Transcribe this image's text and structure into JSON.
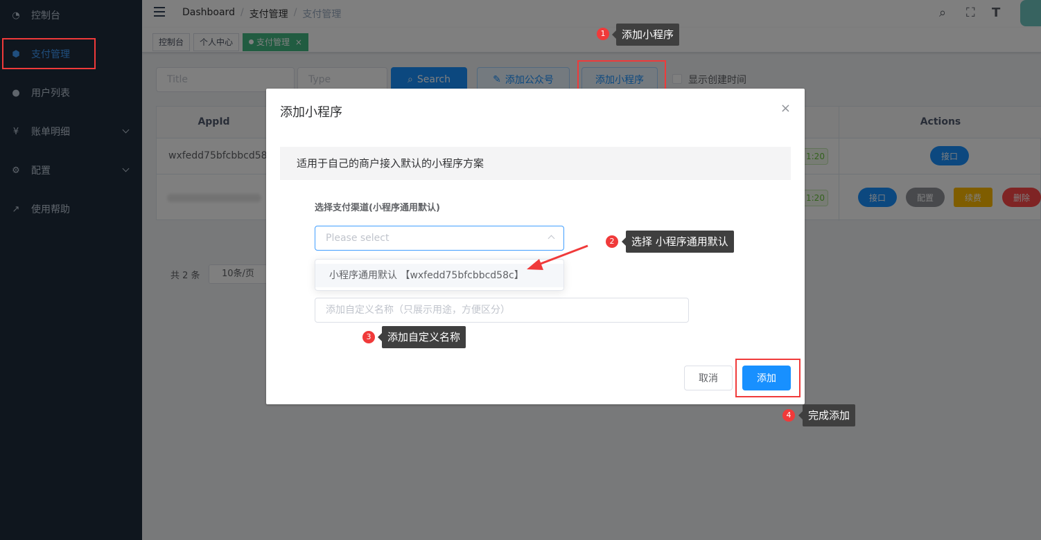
{
  "sidebar": {
    "items": [
      {
        "label": "控制台",
        "icon": "dashboard-icon"
      },
      {
        "label": "支付管理",
        "icon": "shield-icon"
      },
      {
        "label": "用户列表",
        "icon": "users-icon"
      },
      {
        "label": "账单明细",
        "icon": "yen-icon"
      },
      {
        "label": "配置",
        "icon": "gear-icon"
      },
      {
        "label": "使用帮助",
        "icon": "external-link-icon"
      }
    ],
    "active": "支付管理"
  },
  "header": {
    "breadcrumb": [
      "Dashboard",
      "支付管理",
      "支付管理"
    ],
    "sep": "/"
  },
  "tags": [
    "控制台",
    "个人中心",
    "支付管理"
  ],
  "tag_close": "×",
  "filters": {
    "title_placeholder": "Title",
    "type_placeholder": "Type",
    "search_label": "Search",
    "add_official_label": "添加公众号",
    "add_mini_label": "添加小程序",
    "show_time_label": "显示创建时间"
  },
  "table": {
    "headers": [
      "AppId",
      "Actions"
    ],
    "rows": [
      {
        "appid": "wxfedd75bfcbbcd58c",
        "time": "1:20",
        "actions": [
          "接口"
        ]
      },
      {
        "appid": "",
        "time": "1:20",
        "actions": [
          "接口",
          "配置",
          "续费",
          "删除"
        ]
      }
    ]
  },
  "pagination": {
    "total": "共 2 条",
    "page_size": "10条/页"
  },
  "dialog": {
    "title": "添加小程序",
    "close": "×",
    "alert": "适用于自己的商户接入默认的小程序方案",
    "channel_label": "选择支付渠道(小程序通用默认)",
    "select_placeholder": "Please select",
    "option": "小程序通用默认 【wxfedd75bfcbbcd58c】",
    "name_placeholder": "添加自定义名称（只展示用途，方便区分）",
    "cancel": "取消",
    "confirm": "添加"
  },
  "annotations": [
    {
      "num": "1",
      "text": "添加小程序"
    },
    {
      "num": "2",
      "text": "选择 小程序通用默认"
    },
    {
      "num": "3",
      "text": "添加自定义名称"
    },
    {
      "num": "4",
      "text": "完成添加"
    }
  ],
  "colors": {
    "primary": "#1890ff",
    "sidebar": "#1f2d3d",
    "highlight": "#f03a3a",
    "tag_active": "#42b983"
  }
}
